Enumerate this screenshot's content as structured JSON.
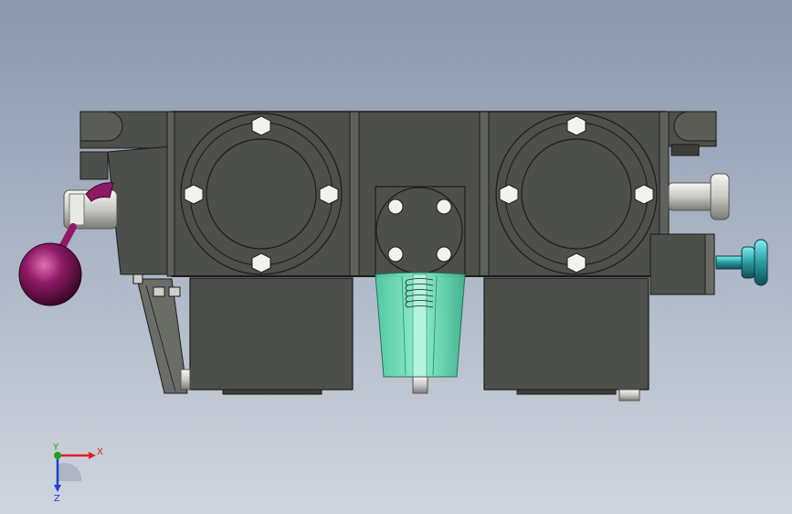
{
  "viewport": {
    "colors": {
      "background_top": "#8a98ad",
      "background_bottom": "#cfd5de",
      "body": "#4d4f4a",
      "body_edge": "#1c1c1c",
      "handle_ball": "#8e1a66",
      "transparent_part": "#5ad6b0",
      "knob": "#2a9aa0",
      "pin": "#d8d8d4"
    }
  },
  "triad": {
    "x_label": "X",
    "y_label": "Y",
    "z_label": "Z",
    "x_color": "#e02020",
    "y_color": "#20a020",
    "z_color": "#2040d0"
  }
}
